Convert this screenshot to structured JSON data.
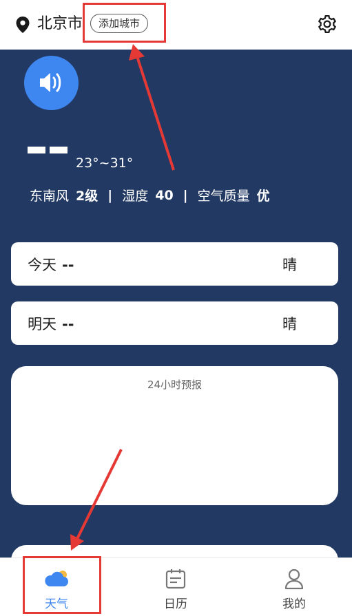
{
  "header": {
    "city": "北京市",
    "add_city_label": "添加城市",
    "location_icon": "location-pin-icon",
    "settings_icon": "gear-icon"
  },
  "current": {
    "temp_range": "23°~31°",
    "wind_label": "东南风",
    "wind_value": "2级",
    "humidity_label": "湿度",
    "humidity_value": "40",
    "air_label": "空气质量",
    "air_value": "优",
    "separator": "|"
  },
  "days": [
    {
      "label": "今天",
      "temp": "--",
      "weather": "晴"
    },
    {
      "label": "明天",
      "temp": "--",
      "weather": "晴"
    }
  ],
  "forecast": {
    "title": "24小时预报"
  },
  "nav": [
    {
      "label": "天气",
      "icon": "cloud-sun-icon",
      "active": true
    },
    {
      "label": "日历",
      "icon": "calendar-icon",
      "active": false
    },
    {
      "label": "我的",
      "icon": "user-icon",
      "active": false
    }
  ],
  "colors": {
    "background": "#223a63",
    "accent": "#3e86f0",
    "highlight": "#e53935"
  }
}
